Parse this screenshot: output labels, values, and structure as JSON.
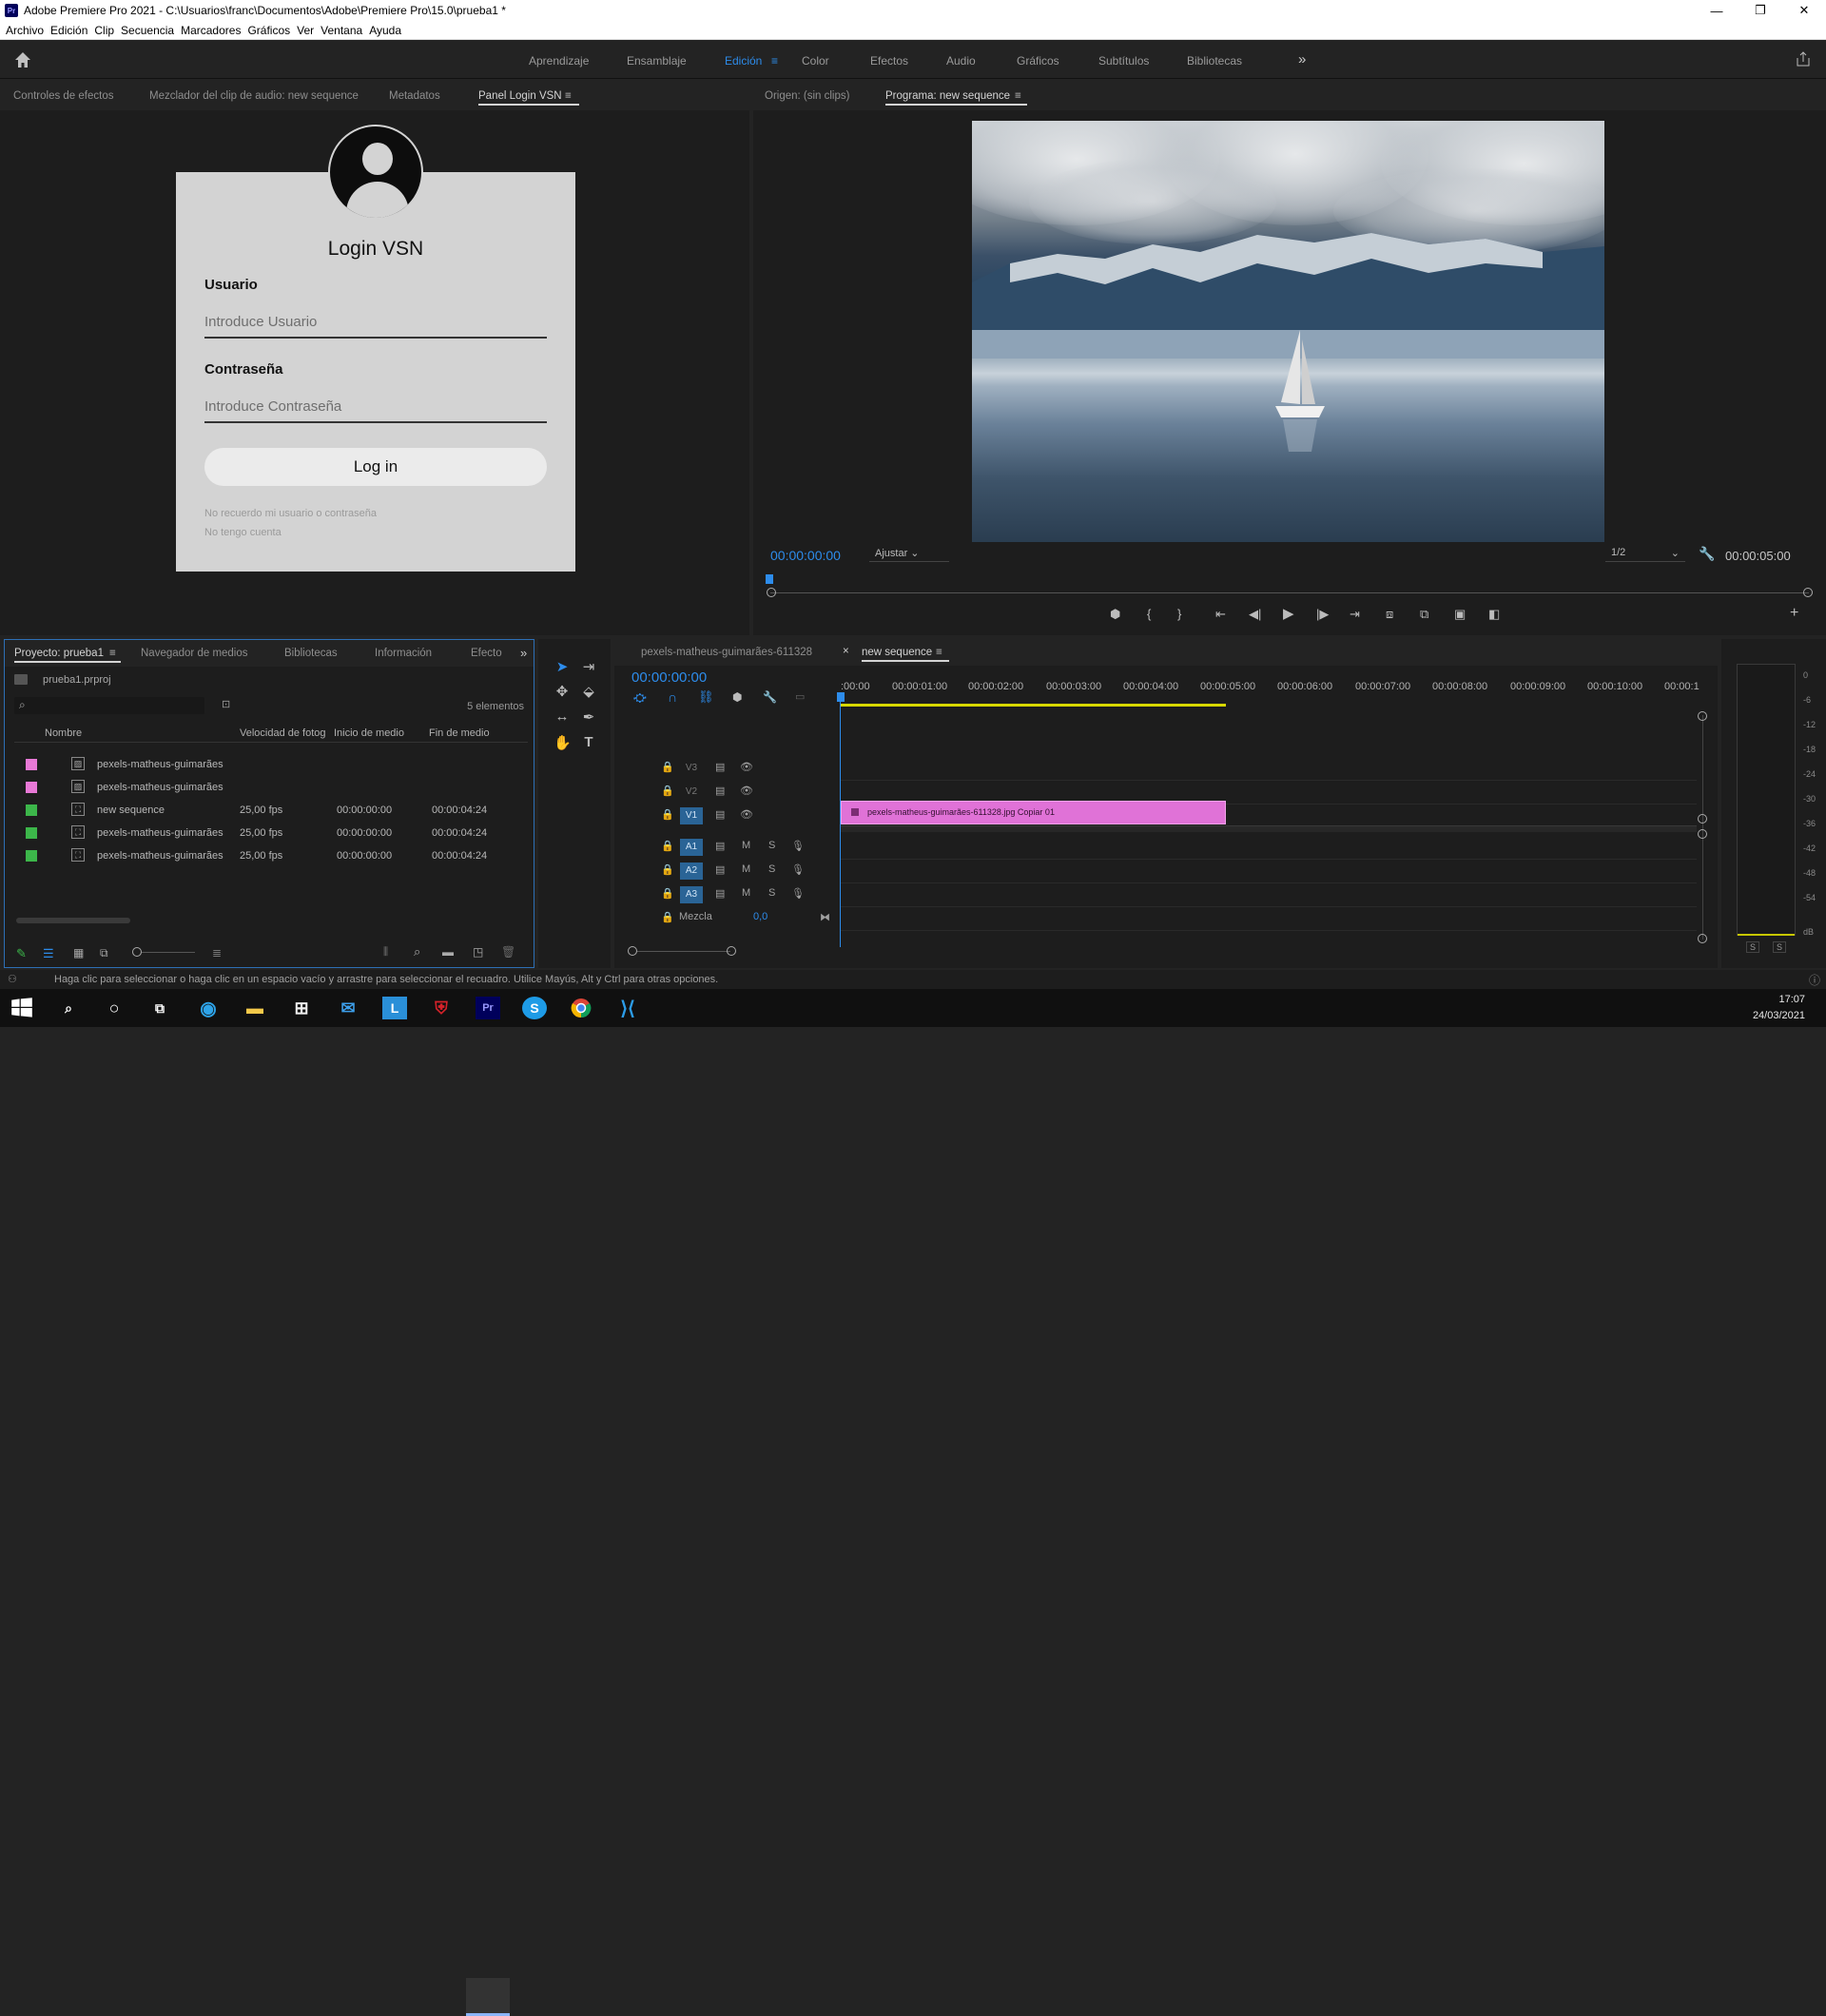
{
  "window": {
    "title": "Adobe Premiere Pro 2021 - C:\\Usuarios\\franc\\Documentos\\Adobe\\Premiere Pro\\15.0\\prueba1 *",
    "app_icon": "Pr",
    "minimize": "—",
    "maximize": "❐",
    "close": "✕"
  },
  "menu": [
    "Archivo",
    "Edición",
    "Clip",
    "Secuencia",
    "Marcadores",
    "Gráficos",
    "Ver",
    "Ventana",
    "Ayuda"
  ],
  "workspaces": {
    "items": [
      "Aprendizaje",
      "Ensamblaje",
      "Edición",
      "Color",
      "Efectos",
      "Audio",
      "Gráficos",
      "Subtítulos",
      "Bibliotecas"
    ],
    "active": "Edición",
    "more": "»",
    "accent": "#2d8ceb"
  },
  "source_panel": {
    "tabs": [
      "Controles de efectos",
      "Mezclador del clip de audio: new sequence",
      "Metadatos",
      "Panel Login VSN"
    ],
    "active_tab": "Panel Login VSN"
  },
  "login": {
    "title": "Login VSN",
    "user_label": "Usuario",
    "user_placeholder": "Introduce Usuario",
    "pass_label": "Contraseña",
    "pass_placeholder": "Introduce Contraseña",
    "button": "Log in",
    "forgot": "No recuerdo mi usuario o contraseña",
    "no_account": "No tengo cuenta"
  },
  "program_monitor": {
    "tabs": [
      "Origen: (sin clips)",
      "Programa: new sequence"
    ],
    "active_tab": "Programa: new sequence",
    "timecode": "00:00:00:00",
    "fit": "Ajustar",
    "resolution": "1/2",
    "duration": "00:00:05:00"
  },
  "project": {
    "tabs": [
      "Proyecto: prueba1",
      "Navegador de medios",
      "Bibliotecas",
      "Información",
      "Efecto"
    ],
    "file": "prueba1.prproj",
    "count": "5 elementos",
    "columns": [
      "Nombre",
      "Velocidad de fotog",
      "Inicio de medio",
      "Fin de medio"
    ],
    "rows": [
      {
        "name": "pexels-matheus-guimarães",
        "fps": "",
        "in": "",
        "out": "",
        "color": "#e879d6",
        "icon": "image-icon"
      },
      {
        "name": "pexels-matheus-guimarães",
        "fps": "",
        "in": "",
        "out": "",
        "color": "#e879d6",
        "icon": "image-icon"
      },
      {
        "name": "new sequence",
        "fps": "25,00 fps",
        "in": "00:00:00:00",
        "out": "00:00:04:24",
        "color": "#3cb64a",
        "icon": "sequence-icon"
      },
      {
        "name": "pexels-matheus-guimarães",
        "fps": "25,00 fps",
        "in": "00:00:00:00",
        "out": "00:00:04:24",
        "color": "#3cb64a",
        "icon": "sequence-icon"
      },
      {
        "name": "pexels-matheus-guimarães",
        "fps": "25,00 fps",
        "in": "00:00:00:00",
        "out": "00:00:04:24",
        "color": "#3cb64a",
        "icon": "sequence-icon"
      }
    ]
  },
  "timeline": {
    "tabs": [
      "pexels-matheus-guimarães-611328",
      "new sequence"
    ],
    "active_tab": "new sequence",
    "close": "×",
    "timecode": "00:00:00:00",
    "ruler": [
      ":00:00",
      "00:00:01:00",
      "00:00:02:00",
      "00:00:03:00",
      "00:00:04:00",
      "00:00:05:00",
      "00:00:06:00",
      "00:00:07:00",
      "00:00:08:00",
      "00:00:09:00",
      "00:00:10:00",
      "00:00:1"
    ],
    "video_tracks": [
      "V3",
      "V2",
      "V1"
    ],
    "audio_tracks": [
      "A1",
      "A2",
      "A3"
    ],
    "mix_label": "Mezcla",
    "mix_value": "0,0",
    "clip_name": "pexels-matheus-guimarães-611328.jpg Copiar 01",
    "clip_color": "#e072d7",
    "mute": "M",
    "solo": "S"
  },
  "meter": {
    "scale": [
      "0",
      "-6",
      "-12",
      "-18",
      "-24",
      "-30",
      "-36",
      "-42",
      "-48",
      "-54",
      "dB"
    ],
    "solo_left": "S",
    "solo_right": "S"
  },
  "status": "Haga clic para seleccionar o haga clic en un espacio vacío y arrastre para seleccionar el recuadro. Utilice Mayús, Alt y Ctrl para otras opciones.",
  "clock": {
    "time": "17:07",
    "date": "24/03/2021"
  },
  "taskbar": {
    "apps": [
      "windows-start-icon",
      "search-icon",
      "cortana-icon",
      "task-view-icon",
      "edge-icon",
      "file-explorer-icon",
      "store-icon",
      "mail-icon",
      "l-app-icon",
      "mcafee-icon",
      "premiere-icon",
      "skype-icon",
      "chrome-icon",
      "vscode-icon"
    ],
    "labels": {
      "premiere": "Pr",
      "skype": "S",
      "lapp": "L"
    }
  }
}
